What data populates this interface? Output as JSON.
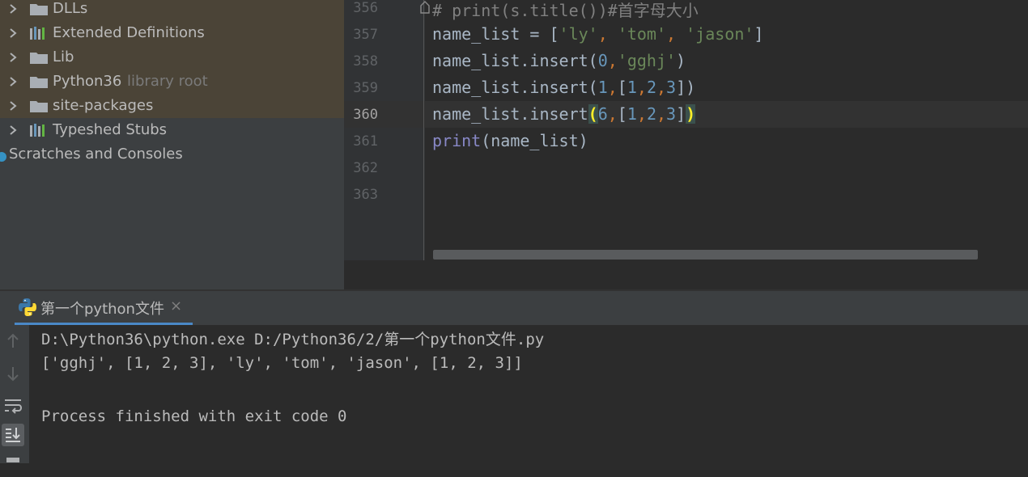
{
  "project_tree": {
    "items": [
      {
        "label": "DLLs",
        "icon": "folder-icon"
      },
      {
        "label": "Extended Definitions",
        "icon": "library-icon"
      },
      {
        "label": "Lib",
        "icon": "folder-icon"
      },
      {
        "label": "Python36",
        "hint": "library root",
        "icon": "folder-icon"
      },
      {
        "label": "site-packages",
        "icon": "folder-icon"
      },
      {
        "label": "Typeshed Stubs",
        "icon": "library-icon"
      },
      {
        "label": "Scratches and Consoles",
        "icon": "scratches-icon"
      }
    ]
  },
  "editor": {
    "line_numbers": [
      "356",
      "357",
      "358",
      "359",
      "360",
      "361",
      "362",
      "363"
    ],
    "current_line": "360",
    "lines": [
      [
        {
          "t": "# print(s.title())#首字母大小",
          "c": "com"
        }
      ],
      [
        {
          "t": "name_list = [",
          "c": "id"
        },
        {
          "t": "'ly'",
          "c": "str"
        },
        {
          "t": ", ",
          "c": "op"
        },
        {
          "t": "'tom'",
          "c": "str"
        },
        {
          "t": ", ",
          "c": "op"
        },
        {
          "t": "'jason'",
          "c": "str"
        },
        {
          "t": "]",
          "c": "id"
        }
      ],
      [
        {
          "t": "name_list.insert(",
          "c": "id"
        },
        {
          "t": "0",
          "c": "num"
        },
        {
          "t": ",",
          "c": "op"
        },
        {
          "t": "'gghj'",
          "c": "str"
        },
        {
          "t": ")",
          "c": "id"
        }
      ],
      [
        {
          "t": "name_list.insert(",
          "c": "id"
        },
        {
          "t": "1",
          "c": "num"
        },
        {
          "t": ",",
          "c": "op"
        },
        {
          "t": "[",
          "c": "id"
        },
        {
          "t": "1",
          "c": "num"
        },
        {
          "t": ",",
          "c": "op"
        },
        {
          "t": "2",
          "c": "num"
        },
        {
          "t": ",",
          "c": "op"
        },
        {
          "t": "3",
          "c": "num"
        },
        {
          "t": "])",
          "c": "id"
        }
      ],
      [
        {
          "t": "name_list.insert",
          "c": "id"
        },
        {
          "t": "(",
          "c": "brace"
        },
        {
          "t": "6",
          "c": "num"
        },
        {
          "t": ",",
          "c": "op"
        },
        {
          "t": "[",
          "c": "id"
        },
        {
          "t": "1",
          "c": "num"
        },
        {
          "t": ",",
          "c": "op"
        },
        {
          "t": "2",
          "c": "num"
        },
        {
          "t": ",",
          "c": "op"
        },
        {
          "t": "3",
          "c": "num"
        },
        {
          "t": "]",
          "c": "id"
        },
        {
          "t": ")",
          "c": "brace"
        }
      ],
      [
        {
          "t": "print",
          "c": "fn"
        },
        {
          "t": "(name_list)",
          "c": "id"
        }
      ],
      [],
      []
    ]
  },
  "run_window": {
    "tab_label": "第一个python文件",
    "close_glyph": "×",
    "output": [
      "D:\\Python36\\python.exe D:/Python36/2/第一个python文件.py",
      "['gghj', [1, 2, 3], 'ly', 'tom', 'jason', [1, 2, 3]]",
      "",
      "Process finished with exit code 0"
    ],
    "toolbar": [
      {
        "icon": "up-arrow-icon"
      },
      {
        "icon": "down-arrow-icon"
      },
      {
        "icon": "soft-wrap-icon"
      },
      {
        "icon": "scroll-to-end-icon",
        "active": true
      }
    ]
  },
  "colors": {
    "background": "#2b2b2b",
    "panel": "#3c3f41",
    "string": "#6a8759",
    "number": "#6897bb",
    "keyword_comma": "#cc7832",
    "builtin": "#8888c6",
    "comment": "#808080",
    "accent": "#4a88c7"
  }
}
